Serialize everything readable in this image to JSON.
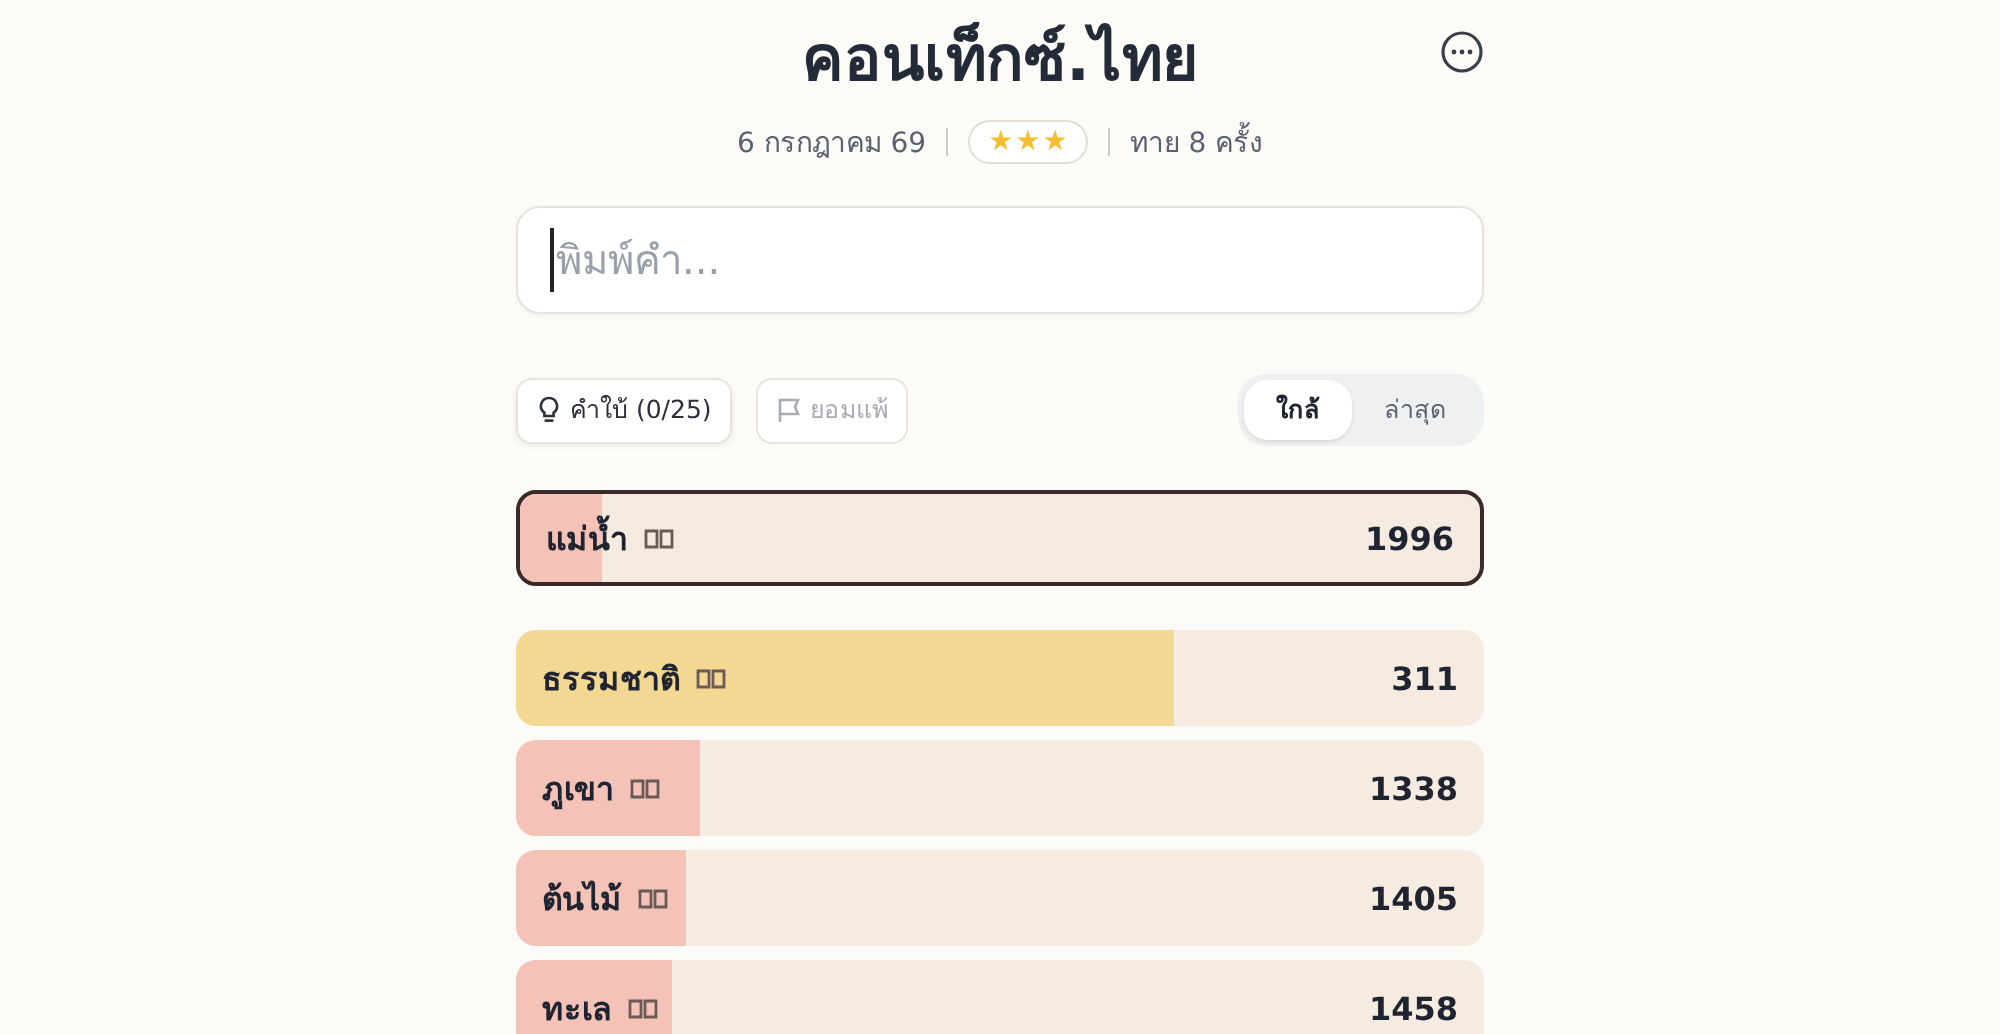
{
  "title": "คอนเท็กซ์.ไทย",
  "date": "6 กรกฎาคม 69",
  "stars": 3,
  "guess_count": "ทาย 8 ครั้ง",
  "input": {
    "placeholder": "พิมพ์คำ..."
  },
  "buttons": [
    {
      "kind": "hint",
      "label": "คำใบ้ (0/25)",
      "disabled": false
    },
    {
      "kind": "give_up",
      "label": "ยอมแพ้",
      "disabled": true
    }
  ],
  "sort_tabs": [
    {
      "label": "ใกล้",
      "selected": true
    },
    {
      "label": "ล่าสุด",
      "selected": false
    }
  ],
  "last_guess": {
    "word": "แม่น้ำ",
    "rank": "1996",
    "level": 0.085,
    "color": "#f5c2b8"
  },
  "guesses": [
    {
      "word": "ธรรมชาติ",
      "rank": "311",
      "level": 0.68,
      "color": "#f2d892"
    },
    {
      "word": "ภูเขา",
      "rank": "1338",
      "level": 0.19,
      "color": "#f5c2b8"
    },
    {
      "word": "ต้นไม้",
      "rank": "1405",
      "level": 0.175,
      "color": "#f5c2b8"
    },
    {
      "word": "ทะเล",
      "rank": "1458",
      "level": 0.162,
      "color": "#f5c2b8"
    }
  ]
}
